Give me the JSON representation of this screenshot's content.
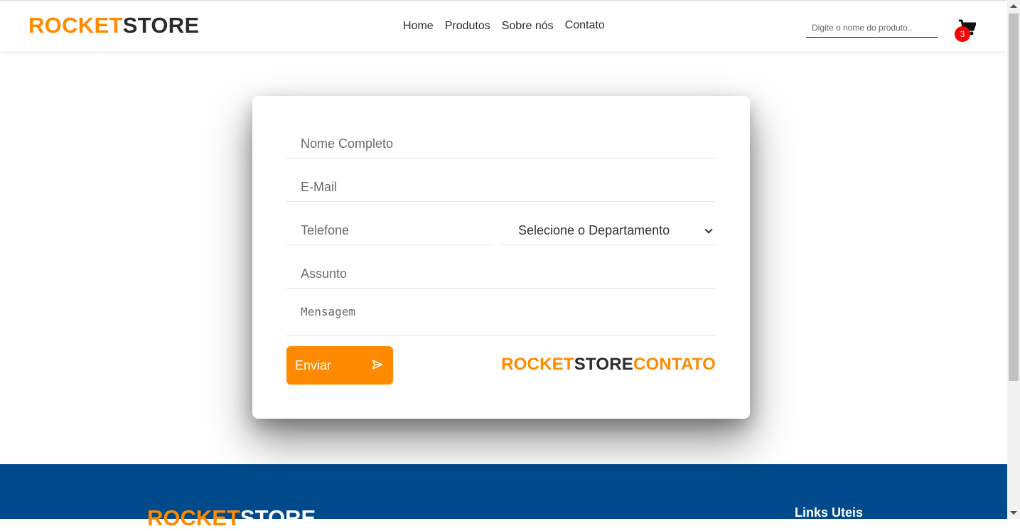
{
  "header": {
    "logo": {
      "part1": "ROCKET",
      "part2": "STORE"
    },
    "nav": [
      {
        "label": "Home"
      },
      {
        "label": "Produtos"
      },
      {
        "label": "Sobre nós"
      },
      {
        "label": "Contato"
      }
    ],
    "search": {
      "placeholder": "Digite o nome do produto.."
    },
    "cart": {
      "count": "3",
      "icon": "shopping-cart-icon"
    }
  },
  "form": {
    "nome_placeholder": "Nome Completo",
    "email_placeholder": "E-Mail",
    "telefone_placeholder": "Telefone",
    "departamento_selected": "Selecione o Departamento",
    "assunto_placeholder": "Assunto",
    "mensagem_placeholder": "Mensagem",
    "send_label": "Enviar",
    "send_icon": "paper-plane-icon",
    "brand": {
      "part1": "ROCKET",
      "part2": "STORE",
      "part3": "CONTATO"
    }
  },
  "footer": {
    "logo": {
      "part1": "ROCKET",
      "part2": "STORE"
    },
    "links_title": "Links Uteis"
  },
  "colors": {
    "accent": "#ff8a00",
    "dark": "#2b2b2b",
    "footer_bg": "#004a8c",
    "badge": "#ff0000"
  }
}
